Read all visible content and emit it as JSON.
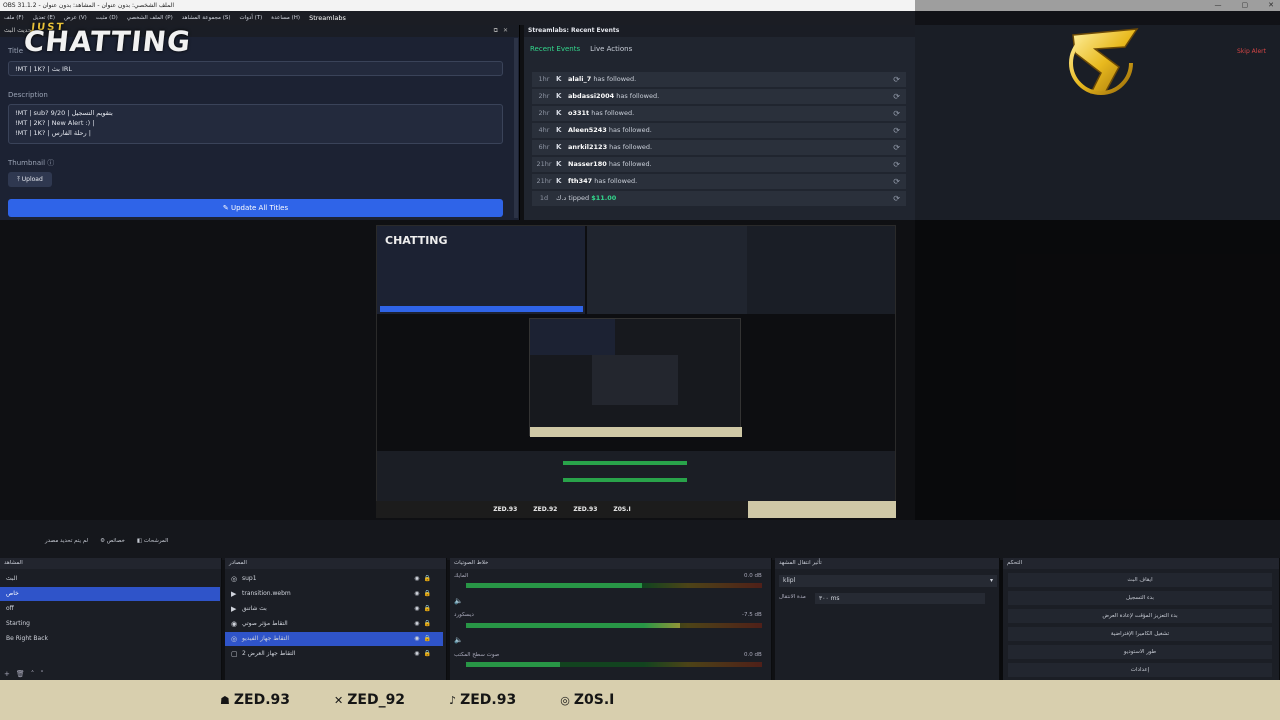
{
  "window": {
    "title": "OBS 31.1.2 - الملف الشخصي: بدون عنوان - المشاهد: بدون عنوان"
  },
  "menu": [
    "ملف (F)",
    "تعديل (E)",
    "عرض (V)",
    "مثبت (D)",
    "الملف الشخصي (P)",
    "مجموعة المشاهد (S)",
    "أدوات (T)",
    "مساعدة (H)",
    "Streamlabs"
  ],
  "titles_dock": {
    "header": "تحديث البث",
    "title_label": "Title",
    "title_value": "!MT | 1K? | بث IRL",
    "description_label": "Description",
    "description_lines": [
      "!MT | sub? 9/20 | بتقويم التسجيل",
      "!MT | 2K? | New Alert :) |",
      "!MT | 1K? | رحلة الفارس |"
    ],
    "thumbnail_label": "Thumbnail",
    "upload_label": "Upload",
    "update_all_label": "Update All Titles",
    "overlay_just": "JUST",
    "overlay_chatting": "CHATTING"
  },
  "events_dock": {
    "header": "Streamlabs: Recent Events",
    "tab_recent": "Recent Events",
    "tab_live": "Live Actions",
    "skip_alert": "Skip Alert",
    "events": [
      {
        "time": "1hr",
        "user": "alali_7",
        "action": "has followed."
      },
      {
        "time": "2hr",
        "user": "abdassi2004",
        "action": "has followed."
      },
      {
        "time": "2hr",
        "user": "o331t",
        "action": "has followed."
      },
      {
        "time": "4hr",
        "user": "Aleen5243",
        "action": "has followed."
      },
      {
        "time": "6hr",
        "user": "anrkil2123",
        "action": "has followed."
      },
      {
        "time": "21hr",
        "user": "Nasser180",
        "action": "has followed."
      },
      {
        "time": "21hr",
        "user": "fth347",
        "action": "has followed."
      }
    ],
    "tip": {
      "time": "1d",
      "user": "د.ك",
      "action": "tipped",
      "amount": "$11.00"
    }
  },
  "scene_tabs": [
    "لم يتم تحديد مصدر",
    "خصائص",
    "المرشحات"
  ],
  "scenes_panel": {
    "header": "المشاهد",
    "items": [
      "البث",
      "خاص",
      "off",
      "Starting",
      "Be Right Back"
    ],
    "selected_index": 1
  },
  "sources_panel": {
    "header": "المصادر",
    "items": [
      {
        "icon": "◎",
        "name": "sup1"
      },
      {
        "icon": "▶",
        "name": "transition.webm"
      },
      {
        "icon": "▶",
        "name": "بث شاتنق"
      },
      {
        "icon": "◉",
        "name": "التقاط مؤثر صوتي"
      },
      {
        "icon": "◎",
        "name": "التقاط جهاز الفيديو"
      },
      {
        "icon": "▢",
        "name": "التقاط جهاز العرض 2"
      }
    ],
    "selected_index": 4
  },
  "mixer_panel": {
    "header": "خلاط الصوتيات",
    "channels": [
      {
        "name": "المايك",
        "db": "0.0 dB"
      },
      {
        "name": "ديسكورد",
        "db": "-7.5 dB"
      },
      {
        "name": "صوت سطح المكتب",
        "db": "0.0 dB"
      }
    ]
  },
  "transitions_panel": {
    "header": "تأثير انتقال المشهد",
    "selected": "klipl",
    "duration_label": "مدة الانتقال",
    "duration_value": "٣٠٠ ms"
  },
  "controls_panel": {
    "header": "التحكم",
    "buttons": [
      "ايقاف البث",
      "بدء التسجيل",
      "بدء التعزيز المؤقت لإعادة العرض",
      "تشغيل الكاميرا الإفتراضية",
      "طور الاستوديو",
      "إعدادات"
    ]
  },
  "preview_socials": [
    "ZED.93",
    "ZED.92",
    "ZED.93",
    "Z0S.I"
  ],
  "footer_socials": [
    {
      "icon": "snapchat-icon",
      "glyph": "☗",
      "label": "ZED.93"
    },
    {
      "icon": "x-icon",
      "glyph": "✕",
      "label": "ZED_92"
    },
    {
      "icon": "tiktok-icon",
      "glyph": "♪",
      "label": "ZED.93"
    },
    {
      "icon": "instagram-icon",
      "glyph": "◎",
      "label": "Z0S.I"
    }
  ],
  "colors": {
    "accent_blue": "#2f64e8",
    "accent_green": "#33d68c",
    "skip_red": "#d54545",
    "logo_gold": "#e9c23a"
  }
}
